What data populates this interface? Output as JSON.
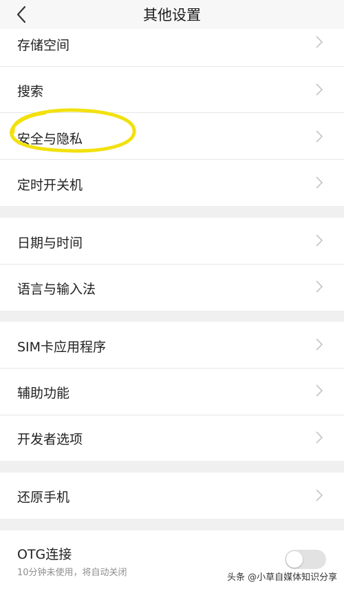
{
  "header": {
    "title": "其他设置",
    "back_icon": "chevron-left-icon"
  },
  "groups": [
    {
      "items": [
        {
          "label": "存储空间"
        },
        {
          "label": "搜索"
        },
        {
          "label": "安全与隐私",
          "highlighted": true
        },
        {
          "label": "定时开关机"
        }
      ]
    },
    {
      "items": [
        {
          "label": "日期与时间"
        },
        {
          "label": "语言与输入法"
        }
      ]
    },
    {
      "items": [
        {
          "label": "SIM卡应用程序"
        },
        {
          "label": "辅助功能"
        },
        {
          "label": "开发者选项"
        }
      ]
    },
    {
      "items": [
        {
          "label": "还原手机"
        }
      ]
    }
  ],
  "otg": {
    "label": "OTG连接",
    "description": "10分钟未使用，将自动关闭",
    "enabled": false
  },
  "watermark": "头条 @小草自媒体知识分享",
  "colors": {
    "highlight_circle": "#f2e10f",
    "section_gap": "#f0f0f0",
    "toggle_off": "#e2e2e2"
  }
}
